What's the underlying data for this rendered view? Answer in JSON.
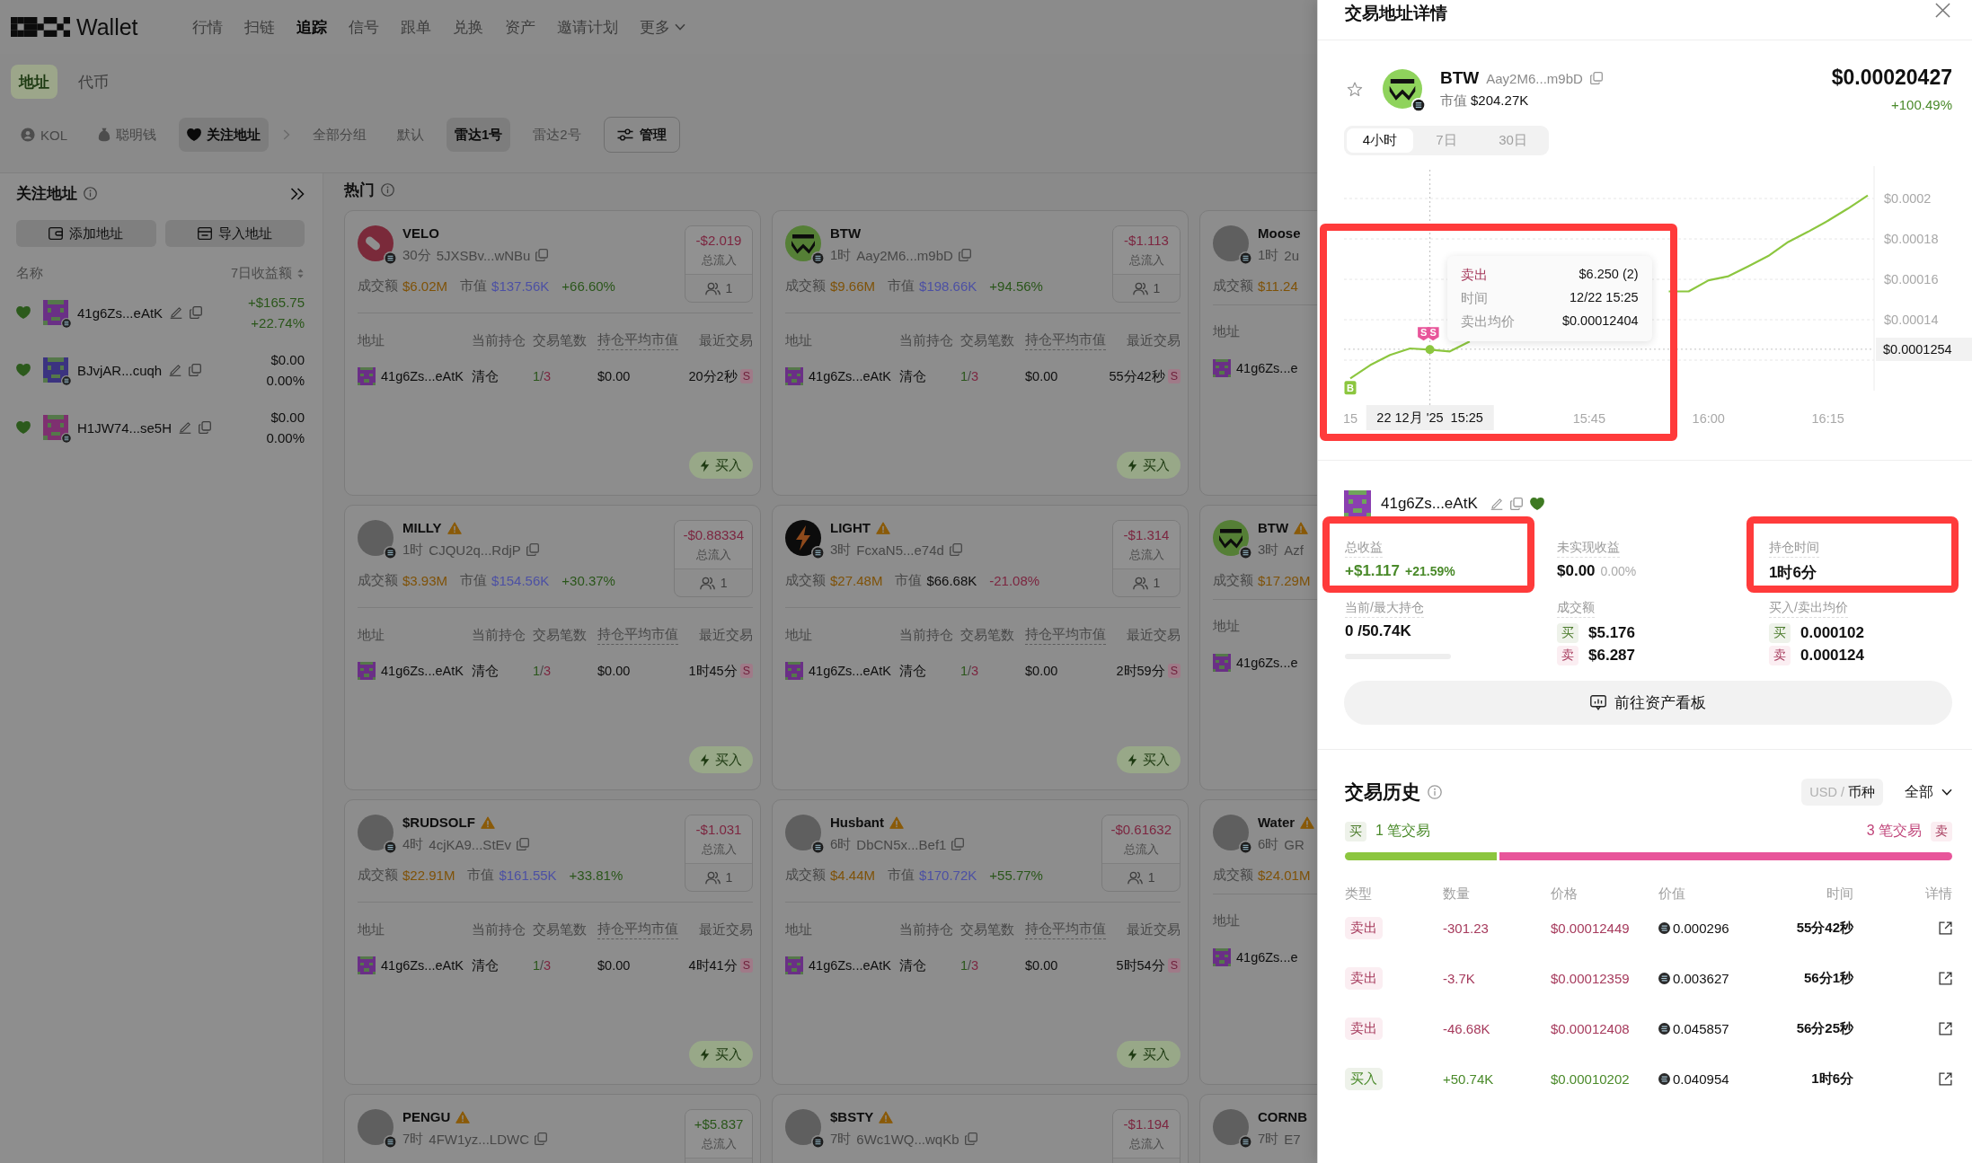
{
  "top_nav": {
    "brand": "Wallet",
    "items": [
      {
        "label": "行情",
        "kind": "link",
        "selected": false
      },
      {
        "label": "扫链",
        "kind": "link",
        "selected": false
      },
      {
        "label": "追踪",
        "kind": "link",
        "selected": true
      },
      {
        "label": "信号",
        "kind": "link",
        "selected": false
      },
      {
        "label": "跟单",
        "kind": "link",
        "selected": false
      },
      {
        "label": "兑换",
        "kind": "link",
        "selected": false
      },
      {
        "label": "资产",
        "kind": "link",
        "selected": false
      },
      {
        "label": "邀请计划",
        "kind": "link",
        "selected": false
      },
      {
        "label": "更多",
        "kind": "menu",
        "selected": false
      }
    ]
  },
  "tabs": [
    {
      "label": "地址",
      "selected": true
    },
    {
      "label": "代币",
      "selected": false
    }
  ],
  "filters": {
    "categories": [
      {
        "label": "KOL",
        "selected": false
      },
      {
        "label": "聪明钱",
        "selected": false
      },
      {
        "label": "关注地址",
        "selected": true
      }
    ],
    "groups": [
      {
        "label": "全部分组",
        "selected": false
      },
      {
        "label": "默认",
        "selected": false
      },
      {
        "label": "雷达1号",
        "selected": true
      },
      {
        "label": "雷达2号",
        "selected": false
      }
    ],
    "manage_button": "管理"
  },
  "sidebar": {
    "title": "关注地址",
    "add_button": "添加地址",
    "import_button": "导入地址",
    "name_column": "名称",
    "pnl_column": "7日收益额",
    "items": [
      {
        "name": "41g6Zs...eAtK",
        "color": "#6a2f86",
        "favorite": true,
        "pnl": "+$165.75",
        "pnl_pct": "+22.74%",
        "gain": true
      },
      {
        "name": "BJvjAR...cuqh",
        "color": "#3b3380",
        "favorite": true,
        "pnl": "$0.00",
        "pnl_pct": "0.00%",
        "gain": false
      },
      {
        "name": "H1JW74...se5H",
        "color": "#7e3070",
        "favorite": true,
        "pnl": "$0.00",
        "pnl_pct": "0.00%",
        "gain": false
      }
    ]
  },
  "hot": {
    "title": "热门",
    "cards": [
      {
        "logo": {
          "kind": "pill"
        },
        "name": "VELO",
        "warning": false,
        "age": "30分",
        "address": "5JXSBv...wNBu",
        "copyable": true,
        "volume_label": "成交额",
        "volume": "$6.02M",
        "mcap_label": "市值",
        "mcap": "$137.56K",
        "mcap_accent": true,
        "change": "+66.60%",
        "change_up": true,
        "flow": "-$2.019",
        "flow_up": false,
        "flow_label": "总流入",
        "followers": "1",
        "columns": [
          "地址",
          "当前持仓",
          "交易笔数",
          "持仓平均市值",
          "最近交易"
        ],
        "rows": [
          {
            "address": "41g6Zs...eAtK",
            "status": "清仓",
            "trades": "1/3",
            "avg_mcap": "$0.00",
            "last_trade": "20分2秒",
            "side": "S"
          }
        ],
        "buy_button": "买入"
      },
      {
        "logo": {
          "kind": "wave"
        },
        "name": "BTW",
        "warning": false,
        "age": "1时",
        "address": "Aay2M6...m9bD",
        "copyable": true,
        "volume_label": "成交额",
        "volume": "$9.66M",
        "mcap_label": "市值",
        "mcap": "$198.66K",
        "mcap_accent": true,
        "change": "+94.56%",
        "change_up": true,
        "flow": "-$1.113",
        "flow_up": false,
        "flow_label": "总流入",
        "followers": "1",
        "columns": [
          "地址",
          "当前持仓",
          "交易笔数",
          "持仓平均市值",
          "最近交易"
        ],
        "rows": [
          {
            "address": "41g6Zs...eAtK",
            "status": "清仓",
            "trades": "1/3",
            "avg_mcap": "$0.00",
            "last_trade": "55分42秒",
            "side": "S"
          }
        ],
        "buy_button": "买入"
      },
      {
        "logo": {
          "kind": "photo"
        },
        "name": "Moose",
        "warning": false,
        "age": "1时",
        "address": "2u",
        "copyable": false,
        "volume_label": "成交额",
        "volume": "$11.24",
        "columns": [
          "地址"
        ],
        "rows": [
          {
            "address": "41g6Zs...e"
          }
        ]
      },
      {
        "logo": {
          "kind": "photo"
        },
        "name": "MILLY",
        "warning": true,
        "age": "1时",
        "address": "CJQU2q...RdjP",
        "copyable": true,
        "volume_label": "成交额",
        "volume": "$3.93M",
        "mcap_label": "市值",
        "mcap": "$154.56K",
        "mcap_accent": true,
        "change": "+30.37%",
        "change_up": true,
        "flow": "-$0.88334",
        "flow_up": false,
        "flow_label": "总流入",
        "followers": "1",
        "columns": [
          "地址",
          "当前持仓",
          "交易笔数",
          "持仓平均市值",
          "最近交易"
        ],
        "rows": [
          {
            "address": "41g6Zs...eAtK",
            "status": "清仓",
            "trades": "1/3",
            "avg_mcap": "$0.00",
            "last_trade": "1时45分",
            "side": "S"
          }
        ],
        "buy_button": "买入"
      },
      {
        "logo": {
          "kind": "bolt"
        },
        "name": "LIGHT",
        "warning": true,
        "age": "3时",
        "address": "FcxaN5...e74d",
        "copyable": true,
        "volume_label": "成交额",
        "volume": "$27.48M",
        "mcap_label": "市值",
        "mcap": "$66.68K",
        "mcap_accent": false,
        "change": "-21.08%",
        "change_up": false,
        "flow": "-$1.314",
        "flow_up": false,
        "flow_label": "总流入",
        "followers": "1",
        "columns": [
          "地址",
          "当前持仓",
          "交易笔数",
          "持仓平均市值",
          "最近交易"
        ],
        "rows": [
          {
            "address": "41g6Zs...eAtK",
            "status": "清仓",
            "trades": "1/3",
            "avg_mcap": "$0.00",
            "last_trade": "2时59分",
            "side": "S"
          }
        ],
        "buy_button": "买入"
      },
      {
        "logo": {
          "kind": "wave"
        },
        "name": "BTW",
        "warning": true,
        "age": "3时",
        "address": "Azf",
        "copyable": false,
        "volume_label": "成交额",
        "volume": "$17.29M",
        "columns": [
          "地址"
        ],
        "rows": [
          {
            "address": "41g6Zs...e"
          }
        ]
      },
      {
        "logo": {
          "kind": "photo"
        },
        "name": "$RUDSOLF",
        "warning": true,
        "age": "4时",
        "address": "4cjKA9...StEv",
        "copyable": true,
        "volume_label": "成交额",
        "volume": "$22.91M",
        "mcap_label": "市值",
        "mcap": "$161.55K",
        "mcap_accent": true,
        "change": "+33.81%",
        "change_up": true,
        "flow": "-$1.031",
        "flow_up": false,
        "flow_label": "总流入",
        "followers": "1",
        "columns": [
          "地址",
          "当前持仓",
          "交易笔数",
          "持仓平均市值",
          "最近交易"
        ],
        "rows": [
          {
            "address": "41g6Zs...eAtK",
            "status": "清仓",
            "trades": "1/3",
            "avg_mcap": "$0.00",
            "last_trade": "4时41分",
            "side": "S"
          }
        ],
        "buy_button": "买入"
      },
      {
        "logo": {
          "kind": "photo"
        },
        "name": "Husbant",
        "warning": true,
        "age": "6时",
        "address": "DbCN5x...Bef1",
        "copyable": true,
        "volume_label": "成交额",
        "volume": "$4.44M",
        "mcap_label": "市值",
        "mcap": "$170.72K",
        "mcap_accent": true,
        "change": "+55.77%",
        "change_up": true,
        "flow": "-$0.61632",
        "flow_up": false,
        "flow_label": "总流入",
        "followers": "1",
        "columns": [
          "地址",
          "当前持仓",
          "交易笔数",
          "持仓平均市值",
          "最近交易"
        ],
        "rows": [
          {
            "address": "41g6Zs...eAtK",
            "status": "清仓",
            "trades": "1/3",
            "avg_mcap": "$0.00",
            "last_trade": "5时54分",
            "side": "S"
          }
        ],
        "buy_button": "买入"
      },
      {
        "logo": {
          "kind": "photo"
        },
        "name": "Water",
        "warning": true,
        "age": "6时",
        "address": "GR",
        "copyable": false,
        "volume_label": "成交额",
        "volume": "$24.01M",
        "columns": [
          "地址"
        ],
        "rows": [
          {
            "address": "41g6Zs...e"
          }
        ]
      },
      {
        "logo": {
          "kind": "photo"
        },
        "name": "PENGU",
        "warning": true,
        "age": "7时",
        "address": "4FW1yz...LDWC",
        "copyable": true,
        "flow": "+$5.837",
        "flow_up": true,
        "flow_label": "总流入"
      },
      {
        "logo": {
          "kind": "photo"
        },
        "name": "$BSTY",
        "warning": true,
        "age": "7时",
        "address": "6Wc1WQ...wqKb",
        "copyable": true,
        "flow": "-$1.194",
        "flow_up": false,
        "flow_label": "总流入"
      },
      {
        "logo": {
          "kind": "photo"
        },
        "name": "CORNB",
        "warning": false,
        "age": "7时",
        "address": "E7",
        "copyable": false
      }
    ]
  },
  "detail_panel": {
    "title": "交易地址详情",
    "token": {
      "logo": {
        "kind": "wave"
      },
      "name": "BTW",
      "address": "Aay2M6...m9bD",
      "mcap_label": "市值",
      "mcap": "$204.27K",
      "price": "$0.00020427",
      "change": "+100.49%",
      "change_up": true,
      "favorite": false
    },
    "timeframes": [
      {
        "label": "4小时",
        "selected": true
      },
      {
        "label": "7日",
        "selected": false
      },
      {
        "label": "30日",
        "selected": false
      }
    ],
    "price_chart": {
      "chart_data": {
        "type": "line",
        "categories": [
          "15",
          null,
          null,
          null,
          null,
          null,
          null,
          null,
          null,
          null,
          null,
          null,
          "15:45",
          null,
          null,
          null,
          null,
          null,
          "16:00",
          null,
          null,
          null,
          null,
          null,
          "16:15",
          null,
          null
        ],
        "values": [
          0.000111,
          0.0001175,
          0.0001226,
          0.0001258,
          0.0001252,
          0.0001243,
          0.0001292,
          null,
          null,
          null,
          null,
          null,
          null,
          null,
          null,
          null,
          0.000154,
          0.000154,
          0.0001595,
          0.0001615,
          0.0001665,
          0.0001715,
          0.0001785,
          0.0001835,
          0.000189,
          0.000195,
          0.0002015
        ],
        "ylim": [
          0.0001049,
          0.000216
        ],
        "yticks": [
          {
            "value": 0.0002,
            "label": "$0.0002"
          },
          {
            "value": 0.00018,
            "label": "$0.00018"
          },
          {
            "value": 0.00016,
            "label": "$0.00016"
          },
          {
            "value": 0.00014,
            "label": "$0.00014"
          }
        ],
        "grid": true,
        "ref_lines": [
          {
            "axis": "y",
            "value": 0.0001254,
            "label": "$0.0001254"
          }
        ]
      },
      "cursor": {
        "time_label": "22 12月 '25  15:25"
      },
      "markers": [
        {
          "kind": "buy",
          "text": "B"
        },
        {
          "kind": "sell",
          "text": "S"
        },
        {
          "kind": "sell",
          "text": "S"
        }
      ],
      "tooltip": {
        "highlighted": true,
        "rows": [
          {
            "label": "卖出",
            "value": "$6.250 (2)",
            "kind": "side"
          },
          {
            "label": "时间",
            "value": "12/22 15:25",
            "kind": "info"
          },
          {
            "label": "卖出均价",
            "value": "$0.00012404",
            "kind": "info"
          }
        ]
      }
    },
    "position": {
      "address": "41g6Zs...eAtK",
      "following": true,
      "stats": [
        {
          "kind": "pnl",
          "label": "总收益",
          "value": "+$1.117",
          "sub": "+21.59%",
          "gain": true,
          "highlighted": true
        },
        {
          "kind": "pnl",
          "label": "未实现收益",
          "value": "$0.00",
          "sub": "0.00%",
          "gain": false,
          "highlighted": false
        },
        {
          "kind": "plain",
          "label": "持仓时间",
          "value": "1时6分",
          "highlighted": true
        },
        {
          "kind": "holding",
          "label": "当前/最大持仓",
          "value": "0 /50.74K",
          "highlighted": false
        },
        {
          "kind": "pair",
          "label": "成交额",
          "buy_tag": "买",
          "buy": "$5.176",
          "sell_tag": "卖",
          "sell": "$6.287",
          "highlighted": false
        },
        {
          "kind": "pair",
          "label": "买入/卖出均价",
          "buy_tag": "买",
          "buy": "0.000102",
          "sell_tag": "卖",
          "sell": "0.000124",
          "highlighted": false
        }
      ],
      "dashboard_button": "前往资产看板"
    },
    "history": {
      "title": "交易历史",
      "units": [
        {
          "label": "USD",
          "selected": false
        },
        {
          "label": "币种",
          "selected": true
        }
      ],
      "unit_separator": "/",
      "filter": "全部",
      "buy_tag": "买",
      "buy_count": "1 笔交易",
      "sell_count": "3 笔交易",
      "sell_tag": "卖",
      "level": 0.25,
      "columns": [
        "类型",
        "数量",
        "价格",
        "价值",
        "时间",
        "详情"
      ],
      "rows": [
        {
          "kind": "sell",
          "type": "卖出",
          "amount": "-301.23",
          "price": "$0.00012449",
          "value": "0.000296",
          "time": "55分42秒"
        },
        {
          "kind": "sell",
          "type": "卖出",
          "amount": "-3.7K",
          "price": "$0.00012359",
          "value": "0.003627",
          "time": "56分1秒"
        },
        {
          "kind": "sell",
          "type": "卖出",
          "amount": "-46.68K",
          "price": "$0.00012408",
          "value": "0.045857",
          "time": "56分25秒"
        },
        {
          "kind": "buy",
          "type": "买入",
          "amount": "+50.74K",
          "price": "$0.00010202",
          "value": "0.040954",
          "time": "1时6分"
        }
      ]
    }
  }
}
